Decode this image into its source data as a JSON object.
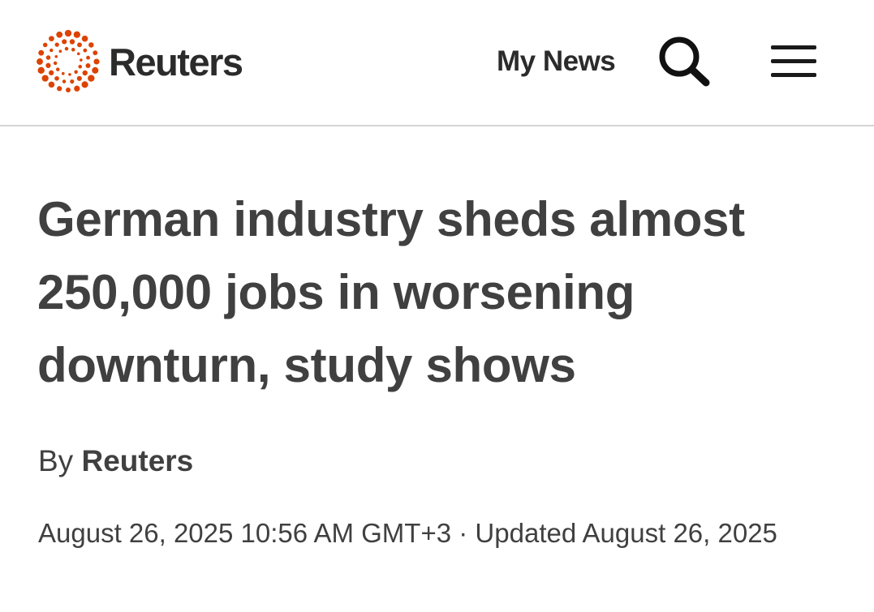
{
  "header": {
    "brand": "Reuters",
    "brand_color": "#dc4300",
    "my_news_label": "My News",
    "icons": [
      "logo-mark",
      "search-icon",
      "menu-icon"
    ]
  },
  "article": {
    "headline": "German industry sheds almost 250,000 jobs in worsening downturn, study shows",
    "byline_prefix": "By",
    "byline_author": "Reuters",
    "published": "August 26, 2025 10:56 AM GMT+3",
    "separator": "·",
    "updated": "Updated August 26, 2025"
  }
}
